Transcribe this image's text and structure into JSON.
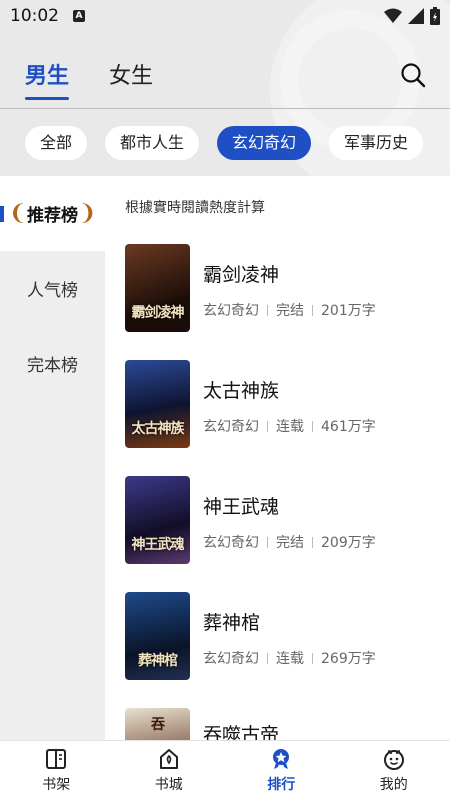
{
  "status_bar": {
    "time": "10:02",
    "notification_badge": "A"
  },
  "gender_tabs": [
    {
      "label": "男生",
      "active": true
    },
    {
      "label": "女生",
      "active": false
    }
  ],
  "categories": [
    {
      "label": "全部",
      "active": false
    },
    {
      "label": "都市人生",
      "active": false
    },
    {
      "label": "玄幻奇幻",
      "active": true
    },
    {
      "label": "军事历史",
      "active": false
    }
  ],
  "rank_menu": [
    {
      "label": "推荐榜",
      "active": true
    },
    {
      "label": "人气榜",
      "active": false
    },
    {
      "label": "完本榜",
      "active": false
    }
  ],
  "hint": "根據實時閱讀熱度計算",
  "books": [
    {
      "title": "霸剑凌神",
      "genre": "玄幻奇幻",
      "status": "完结",
      "words": "201万字",
      "cover_text": "霸剑凌神",
      "cover_color": "#3a1c12"
    },
    {
      "title": "太古神族",
      "genre": "玄幻奇幻",
      "status": "连载",
      "words": "461万字",
      "cover_text": "太古神族",
      "cover_color": "#1c2a5a"
    },
    {
      "title": "神王武魂",
      "genre": "玄幻奇幻",
      "status": "完结",
      "words": "209万字",
      "cover_text": "神王武魂",
      "cover_color": "#2a1f4a"
    },
    {
      "title": "葬神棺",
      "genre": "玄幻奇幻",
      "status": "连载",
      "words": "269万字",
      "cover_text": "葬神棺",
      "cover_color": "#152c4e"
    },
    {
      "title": "吞噬古帝",
      "genre": "",
      "status": "",
      "words": "",
      "cover_text": "吞",
      "cover_color": "#4a3020"
    }
  ],
  "bottom_nav": [
    {
      "label": "书架",
      "icon": "bookshelf-icon",
      "active": false
    },
    {
      "label": "书城",
      "icon": "store-icon",
      "active": false
    },
    {
      "label": "排行",
      "icon": "ranking-icon",
      "active": true
    },
    {
      "label": "我的",
      "icon": "profile-icon",
      "active": false
    }
  ],
  "colors": {
    "accent": "#1f4fc4",
    "header_bg": "#e9e9ea",
    "side_bg": "#eeeeef"
  }
}
